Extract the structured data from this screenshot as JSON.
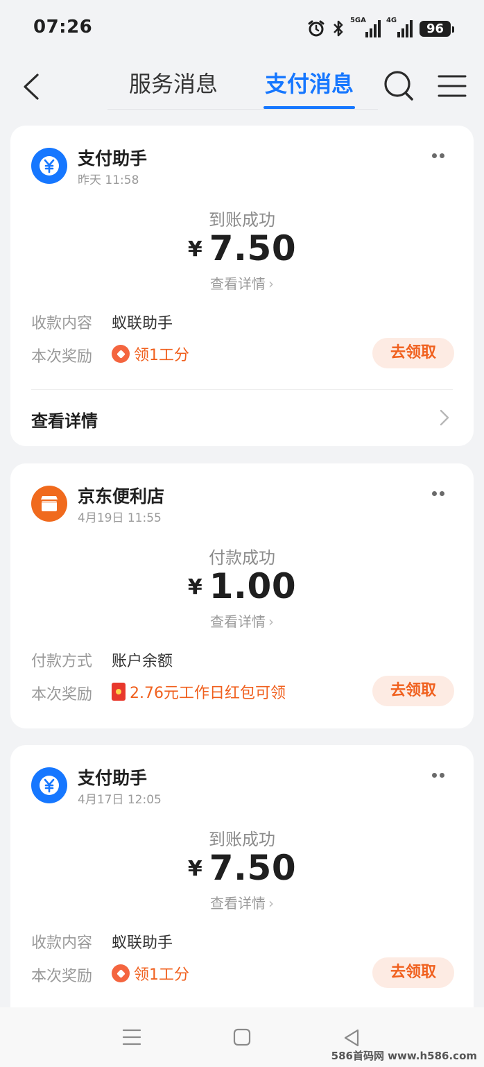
{
  "status_bar": {
    "time": "07:26",
    "net1": "5GA",
    "net2": "4G",
    "battery": "96"
  },
  "nav": {
    "tab_service": "服务消息",
    "tab_pay": "支付消息"
  },
  "cards": [
    {
      "sender": "支付助手",
      "time": "昨天 11:58",
      "status": "到账成功",
      "currency": "¥",
      "amount": "7.50",
      "detail_link": "查看详情",
      "row1_label": "收款内容",
      "row1_value": "蚁联助手",
      "reward_label": "本次奖励",
      "reward_value": "领1工分",
      "claim_label": "去领取",
      "footer_link": "查看详情"
    },
    {
      "sender": "京东便利店",
      "time": "4月19日 11:55",
      "status": "付款成功",
      "currency": "¥",
      "amount": "1.00",
      "detail_link": "查看详情",
      "row1_label": "付款方式",
      "row1_value": "账户余额",
      "reward_label": "本次奖励",
      "reward_value": "2.76元工作日红包可领",
      "claim_label": "去领取"
    },
    {
      "sender": "支付助手",
      "time": "4月17日 12:05",
      "status": "到账成功",
      "currency": "¥",
      "amount": "7.50",
      "detail_link": "查看详情",
      "row1_label": "收款内容",
      "row1_value": "蚁联助手",
      "reward_label": "本次奖励",
      "reward_value": "领1工分",
      "claim_label": "去领取"
    }
  ],
  "watermark": "586首码网 www.h586.com",
  "colors": {
    "accent": "#1677ff",
    "reward": "#f0601e",
    "claim_bg": "#fdebe3"
  }
}
